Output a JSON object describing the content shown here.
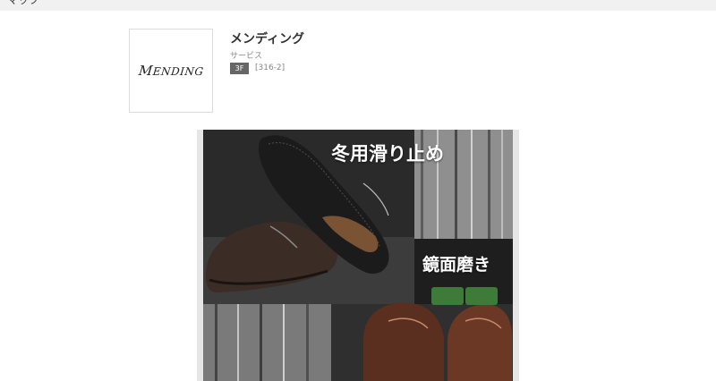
{
  "header": {
    "title": "マップ"
  },
  "shop": {
    "logo_text": "MENDING",
    "name": "メンディング",
    "category": "サービス",
    "floor": "3F",
    "code": "[316-2]"
  },
  "promo": {
    "caption_top": "冬用滑り止め",
    "caption_mid": "鏡面磨き"
  }
}
